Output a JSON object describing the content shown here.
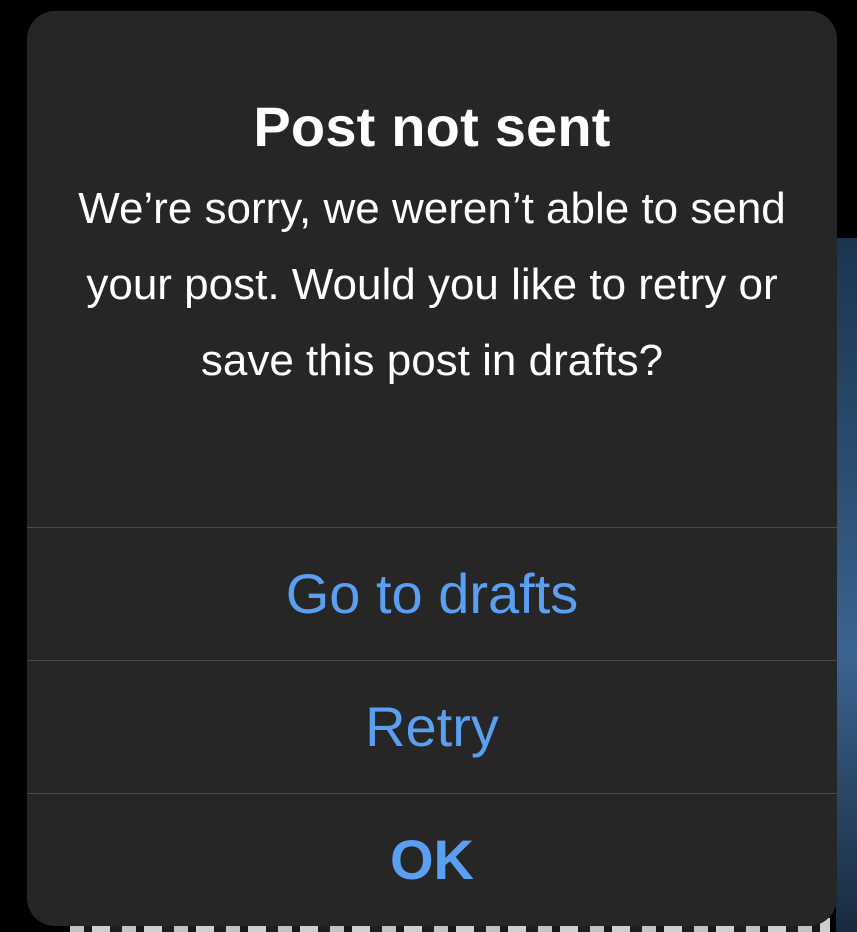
{
  "dialog": {
    "title": "Post not sent",
    "message": "We’re sorry, we weren’t able to send your post. Would you like to retry or save this post in drafts?",
    "actions": [
      {
        "label": "Go to drafts"
      },
      {
        "label": "Retry"
      },
      {
        "label": "OK"
      }
    ]
  },
  "colors": {
    "dialog_background": "#262626",
    "action_text": "#5b9ff0",
    "title_text": "#ffffff",
    "separator": "#4a4a4a"
  }
}
